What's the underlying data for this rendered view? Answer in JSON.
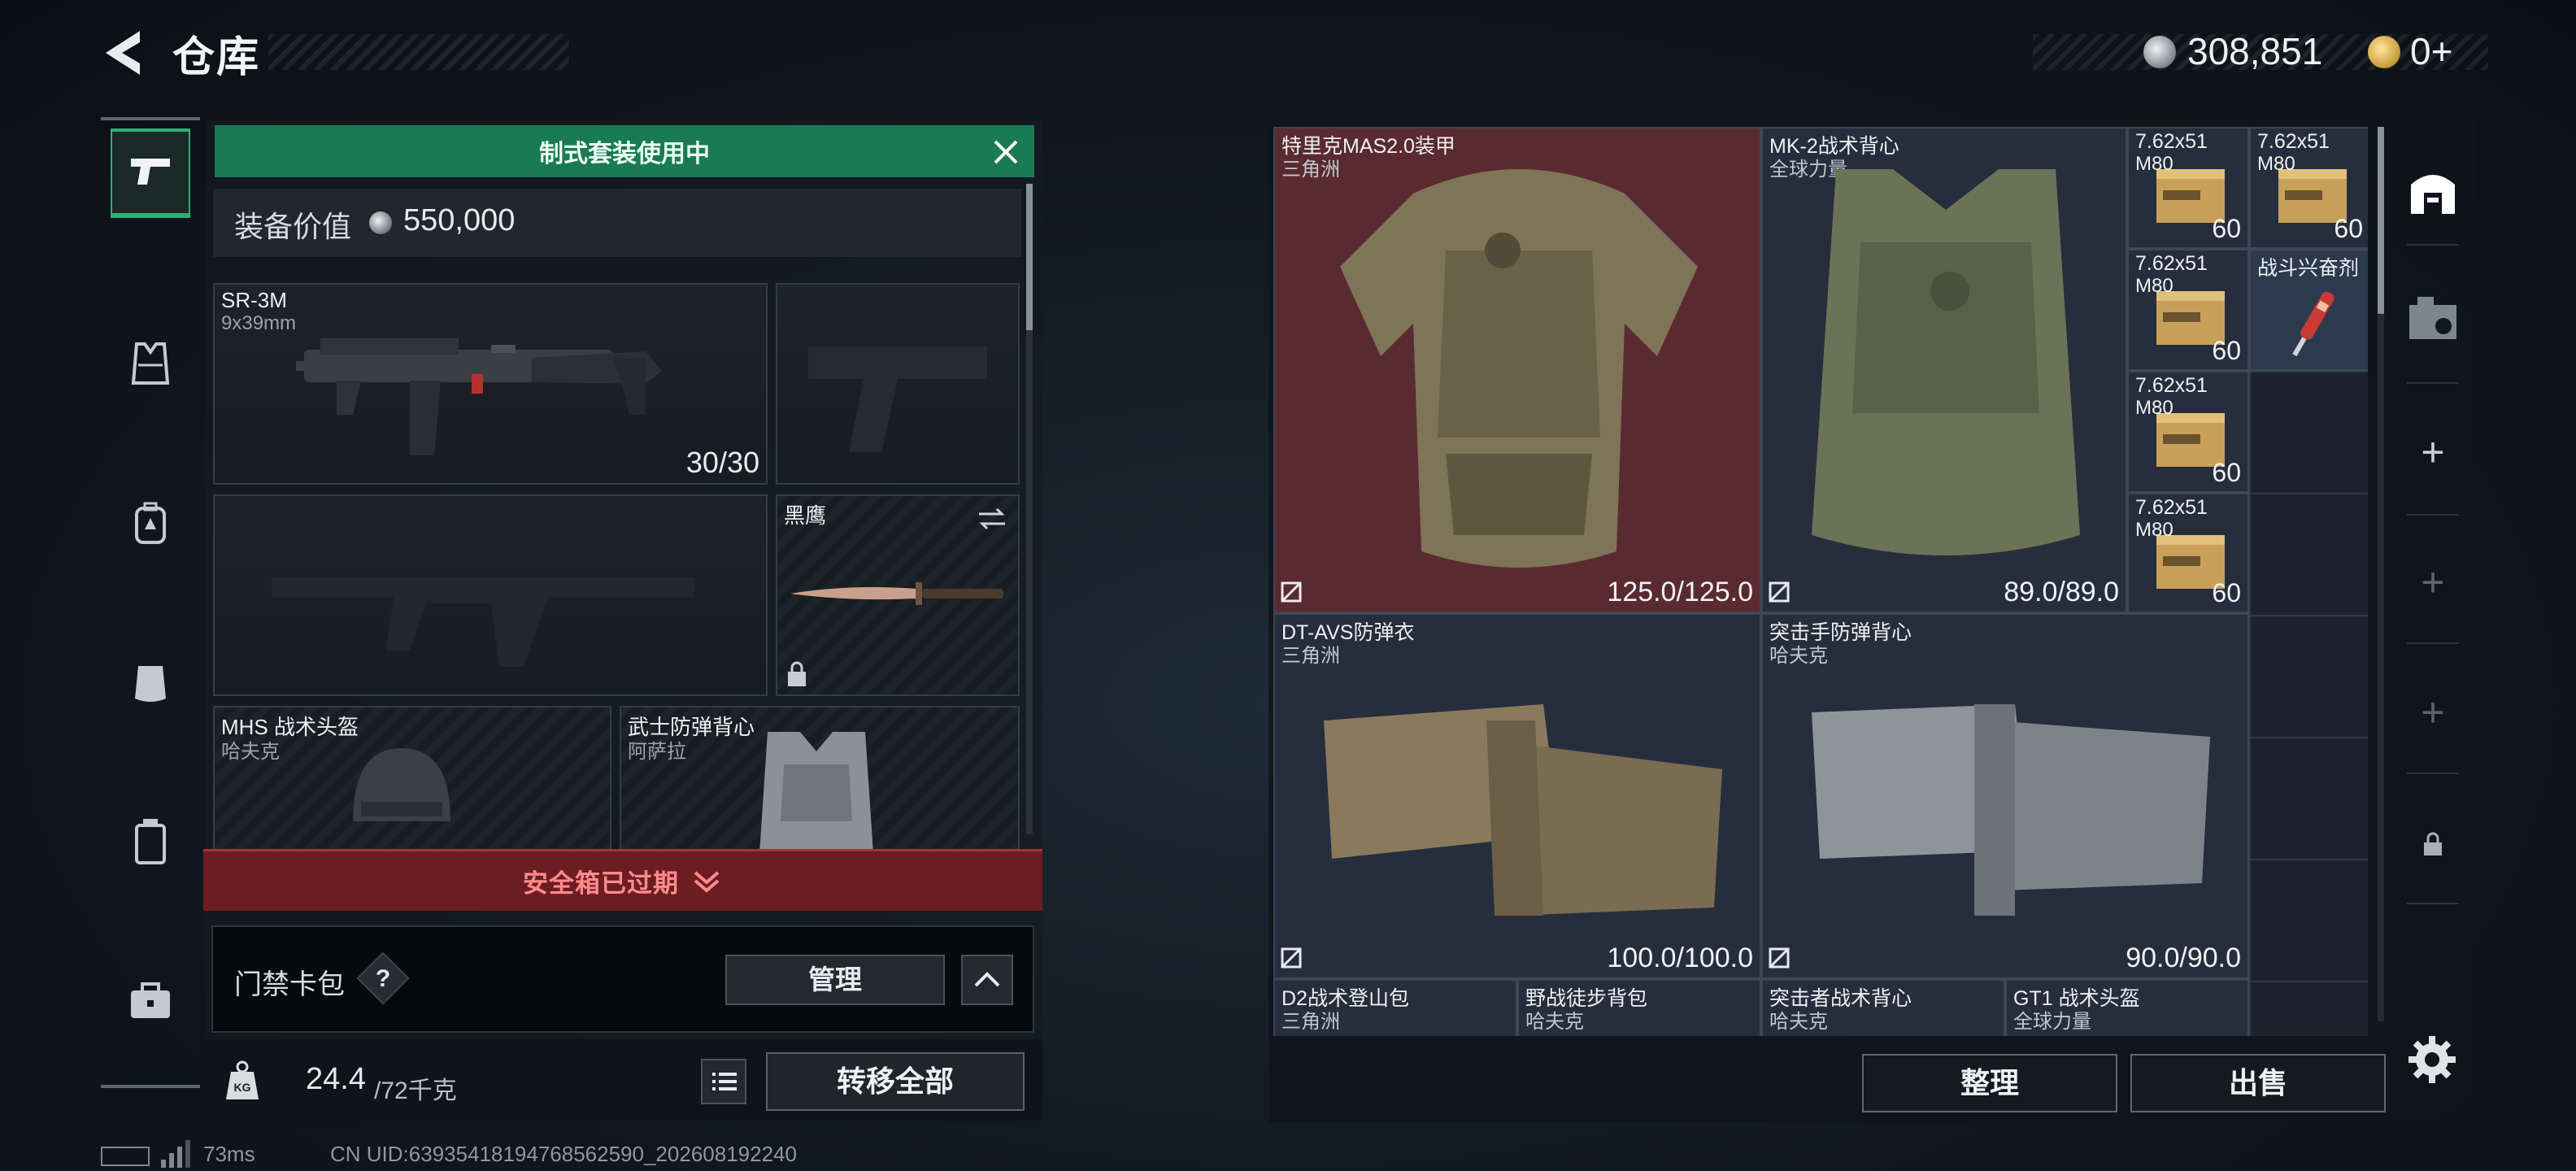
{
  "header": {
    "title": "仓库",
    "currency_silver": "308,851",
    "currency_gold": "0+"
  },
  "loadout": {
    "banner": "制式套装使用中",
    "value_label": "装备价值",
    "value_amount": "550,000",
    "slots": {
      "primary": {
        "name": "SR-3M",
        "sub": "9x39mm",
        "ammo": "30/30"
      },
      "knife": {
        "name": "黑鹰"
      },
      "helmet": {
        "name": "MHS 战术头盔",
        "sub": "哈夫克"
      },
      "vest": {
        "name": "武士防弹背心",
        "sub": "阿萨拉"
      }
    },
    "expired": "安全箱已过期",
    "card_label": "门禁卡包",
    "card_help": "?",
    "manage": "管理",
    "weight_value": "24.4",
    "weight_max": "/72千克",
    "transfer": "转移全部"
  },
  "footer": {
    "ping": "73ms",
    "uid": "CN UID:639354181947685625​90_202608192240"
  },
  "stash": {
    "items": [
      {
        "name": "特里克MAS2.0装甲",
        "sub": "三角洲",
        "durability": "125.0/125.0"
      },
      {
        "name": "MK-2战术背心",
        "sub": "全球力量",
        "durability": "89.0/89.0"
      },
      {
        "name": "DT-AVS防弹衣",
        "sub": "三角洲",
        "durability": "100.0/100.0"
      },
      {
        "name": "突击手防弹背心",
        "sub": "哈夫克",
        "durability": "90.0/90.0"
      },
      {
        "name": "D2战术登山包",
        "sub": "三角洲"
      },
      {
        "name": "野战徒步背包",
        "sub": "哈夫克"
      },
      {
        "name": "突击者战术背心",
        "sub": "哈夫克"
      },
      {
        "name": "GT1 战术头盔",
        "sub": "全球力量"
      }
    ],
    "ammo": [
      {
        "name": "7.62x51",
        "sub": "M80",
        "count": "60"
      },
      {
        "name": "7.62x51",
        "sub": "M80",
        "count": "60"
      },
      {
        "name": "7.62x51",
        "sub": "M80",
        "count": "60"
      },
      {
        "name": "7.62x51",
        "sub": "M80",
        "count": "60"
      },
      {
        "name": "7.62x51",
        "sub": "M80",
        "count": "60"
      }
    ],
    "consumable": {
      "name": "战斗兴奋剂"
    },
    "sort": "整理",
    "sell": "出售"
  },
  "colors": {
    "accent_green": "#1a7a52",
    "expired_red": "#6b1d22",
    "selected_red": "#5a2a31"
  }
}
